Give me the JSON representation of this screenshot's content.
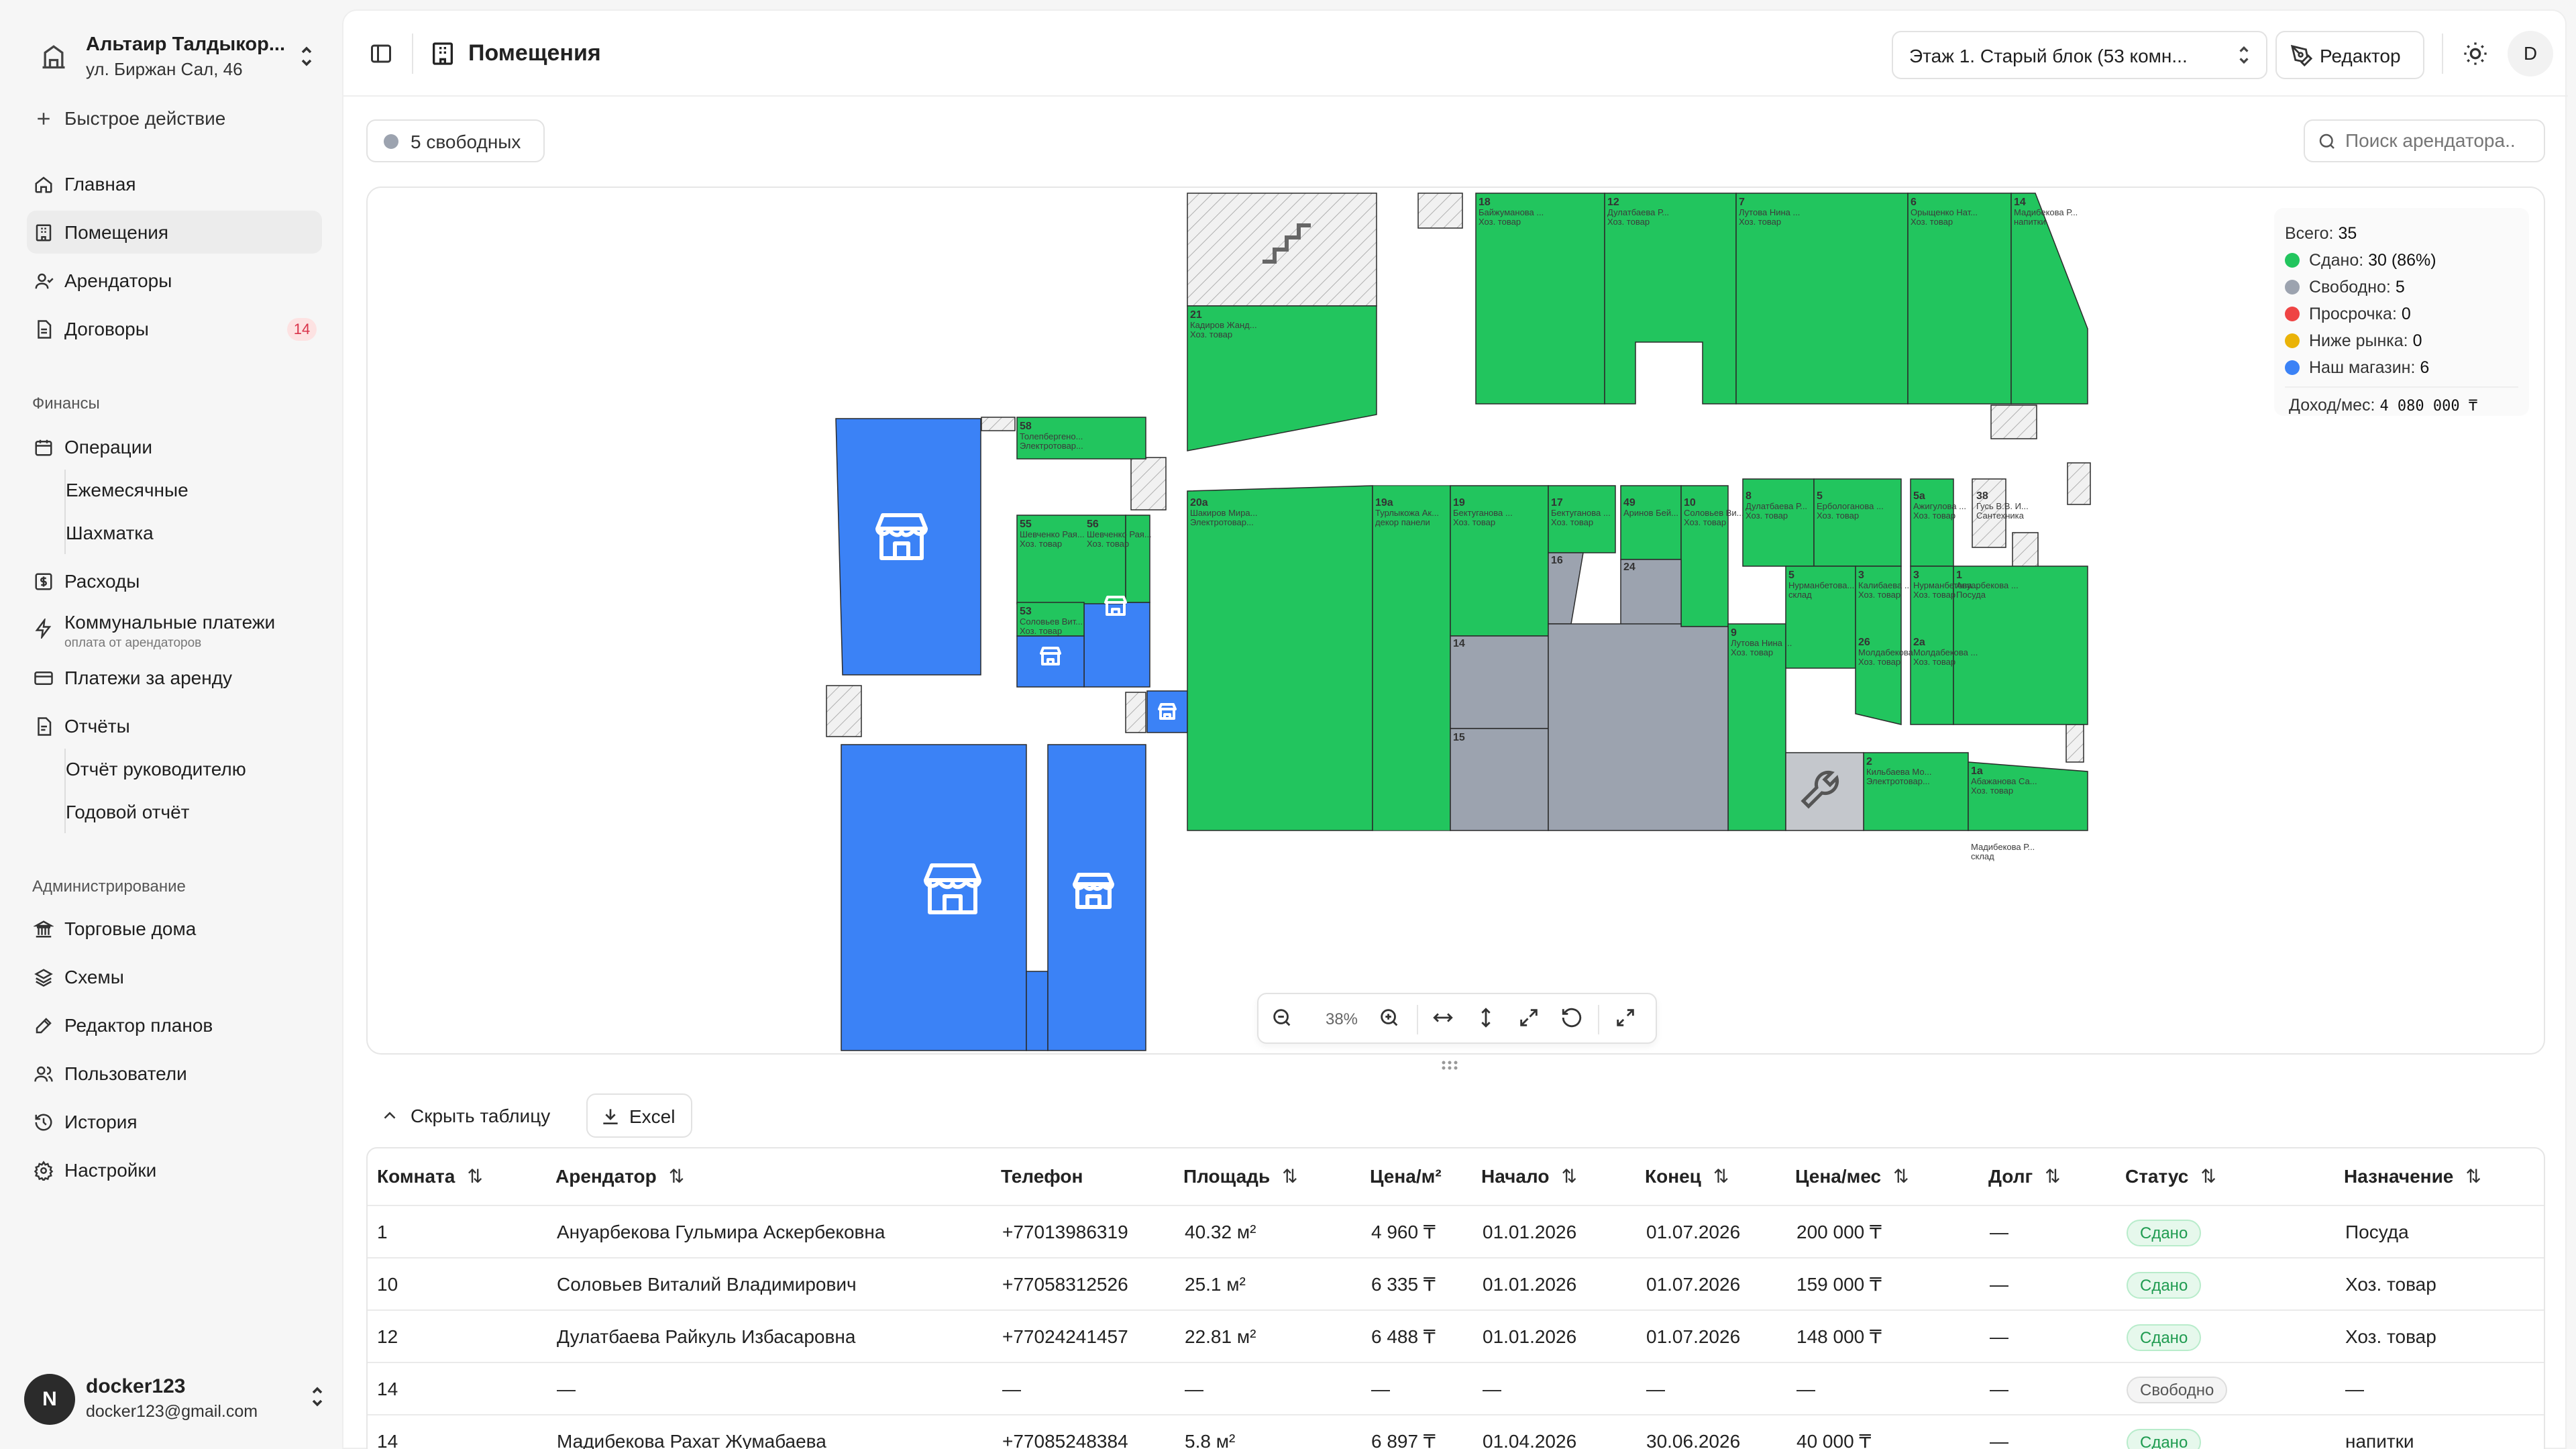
{
  "org": {
    "name": "Альтаир Талдыкор...",
    "address": "ул. Биржан Сал, 46"
  },
  "quick_action": "Быстрое действие",
  "nav": {
    "home": "Главная",
    "rooms": "Помещения",
    "tenants": "Арендаторы",
    "contracts": "Договоры",
    "contracts_badge": "14"
  },
  "finance": {
    "title": "Финансы",
    "operations": "Операции",
    "monthly": "Ежемесячные",
    "chess": "Шахматка",
    "expenses": "Расходы",
    "utilities": "Коммунальные платежи",
    "utilities_sub": "оплата от арендаторов",
    "rent": "Платежи за аренду",
    "reports": "Отчёты",
    "report_manager": "Отчёт руководителю",
    "report_year": "Годовой отчёт"
  },
  "admin": {
    "title": "Администрирование",
    "malls": "Торговые дома",
    "schemes": "Схемы",
    "plan_editor": "Редактор планов",
    "users": "Пользователи",
    "history": "История",
    "settings": "Настройки"
  },
  "user": {
    "initial": "N",
    "name": "docker123",
    "email": "docker123@gmail.com"
  },
  "header": {
    "title": "Помещения",
    "floor_select": "Этаж 1. Старый блок (53 комн...",
    "editor": "Редактор",
    "user_initial": "D"
  },
  "filter": {
    "free_label": "5 свободных",
    "search_placeholder": "Поиск арендатора.."
  },
  "legend": {
    "total_label": "Всего:",
    "total": "35",
    "rented_label": "Сдано:",
    "rented": "30 (86%)",
    "free_label": "Свободно:",
    "free": "5",
    "overdue_label": "Просрочка:",
    "overdue": "0",
    "below_label": "Ниже рынка:",
    "below": "0",
    "own_label": "Наш магазин:",
    "own": "6",
    "income_label": "Доход/мес:",
    "income": "4 080 000 ₸"
  },
  "zoom": {
    "level": "38%"
  },
  "table_controls": {
    "hide": "Скрыть таблицу",
    "excel": "Excel"
  },
  "table": {
    "columns": [
      "Комната",
      "Арендатор",
      "Телефон",
      "Площадь",
      "Цена/м²",
      "Начало",
      "Конец",
      "Цена/мес",
      "Долг",
      "Статус",
      "Назначение"
    ],
    "rows": [
      {
        "room": "1",
        "tenant": "Ануарбекова Гульмира Аскербековна",
        "phone": "+77013986319",
        "area": "40.32 м²",
        "price_m2": "4 960 ₸",
        "start": "01.01.2026",
        "end": "01.07.2026",
        "price_month": "200 000 ₸",
        "debt": "—",
        "status": "Сдано",
        "purpose": "Посуда"
      },
      {
        "room": "10",
        "tenant": "Соловьев Виталий Владимирович",
        "phone": "+77058312526",
        "area": "25.1 м²",
        "price_m2": "6 335 ₸",
        "start": "01.01.2026",
        "end": "01.07.2026",
        "price_month": "159 000 ₸",
        "debt": "—",
        "status": "Сдано",
        "purpose": "Хоз. товар"
      },
      {
        "room": "12",
        "tenant": "Дулатбаева Райкуль Избасаровна",
        "phone": "+77024241457",
        "area": "22.81 м²",
        "price_m2": "6 488 ₸",
        "start": "01.01.2026",
        "end": "01.07.2026",
        "price_month": "148 000 ₸",
        "debt": "—",
        "status": "Сдано",
        "purpose": "Хоз. товар"
      },
      {
        "room": "14",
        "tenant": "—",
        "phone": "—",
        "area": "—",
        "price_m2": "—",
        "start": "—",
        "end": "—",
        "price_month": "—",
        "debt": "—",
        "status": "Свободно",
        "purpose": "—"
      },
      {
        "room": "14",
        "tenant": "Мадибекова Рахат Жумабаева",
        "phone": "+77085248384",
        "area": "5.8 м²",
        "price_m2": "6 897 ₸",
        "start": "01.04.2026",
        "end": "30.06.2026",
        "price_month": "40 000 ₸",
        "debt": "—",
        "status": "Сдано",
        "purpose": "напитки"
      }
    ]
  },
  "colors": {
    "rented": "#22c55e",
    "free": "#9ca3af",
    "overdue": "#ef4444",
    "below": "#eab308",
    "own": "#3b82f6"
  },
  "map_rooms": [
    {
      "no": "18",
      "name": "Байжуманова ...",
      "kind": "Хоз. товар"
    },
    {
      "no": "12",
      "name": "Дулатбаева Р...",
      "kind": "Хоз. товар"
    },
    {
      "no": "7",
      "name": "Лутова Нина ...",
      "kind": "Хоз. товар"
    },
    {
      "no": "6",
      "name": "Орыщенко Нат...",
      "kind": "Хоз. товар"
    },
    {
      "no": "14",
      "name": "Мадибекова Р...",
      "kind": "напитки"
    },
    {
      "no": "21",
      "name": "Кадиров Жанд...",
      "kind": "Хоз. товар"
    },
    {
      "no": "58",
      "name": "Толепбергено...",
      "kind": "Электротовар..."
    },
    {
      "no": "20a",
      "name": "Шакиров Мира...",
      "kind": "Электротовар..."
    },
    {
      "no": "19a",
      "name": "Турлыкожа Ак...",
      "kind": "декор панели"
    },
    {
      "no": "19",
      "name": "Бектуганова ...",
      "kind": "Хоз. товар"
    },
    {
      "no": "17",
      "name": "Бектуганова ...",
      "kind": "Хоз. товар"
    },
    {
      "no": "49",
      "name": "Аринов Бей...",
      "kind": ""
    },
    {
      "no": "10",
      "name": "Соловьев Ви...",
      "kind": "Хоз. товар"
    },
    {
      "no": "8",
      "name": "Дулатбаева Р...",
      "kind": "Хоз. товар"
    },
    {
      "no": "5",
      "name": "Ербологанова ...",
      "kind": "Хоз. товар"
    },
    {
      "no": "5a",
      "name": "Ажигулова ...",
      "kind": "Хоз. товар"
    },
    {
      "no": "38",
      "name": "Гусь В.В. И...",
      "kind": "Сантехника"
    },
    {
      "no": "55",
      "name": "Шевченко Рая...",
      "kind": "Хоз. товар"
    },
    {
      "no": "56",
      "name": "Шевченко Рая...",
      "kind": "Хоз. товар"
    },
    {
      "no": "53",
      "name": "Соловьев Вит...",
      "kind": "Хоз. товар"
    },
    {
      "no": "16",
      "name": "",
      "kind": ""
    },
    {
      "no": "24",
      "name": "",
      "kind": ""
    },
    {
      "no": "14",
      "name": "",
      "kind": ""
    },
    {
      "no": "15",
      "name": "",
      "kind": ""
    },
    {
      "no": "9",
      "name": "Лутова Нина ...",
      "kind": "Хоз. товар"
    },
    {
      "no": "5",
      "name": "Нурманбетова...",
      "kind": "склад"
    },
    {
      "no": "3",
      "name": "Калибаева ...",
      "kind": "Хоз. товар"
    },
    {
      "no": "3",
      "name": "Нурманбетова...",
      "kind": "Хоз. товар"
    },
    {
      "no": "1",
      "name": "Ануарбекова ...",
      "kind": "Посуда"
    },
    {
      "no": "26",
      "name": "Молдабекова ...",
      "kind": "Хоз. товар"
    },
    {
      "no": "2a",
      "name": "Молдабекова ...",
      "kind": "Хоз. товар"
    },
    {
      "no": "2",
      "name": "Кильбаева Мо...",
      "kind": "Электротовар..."
    },
    {
      "no": "1a",
      "name": "Абажанова Са...",
      "kind": "Хоз. товар"
    },
    {
      "no": "",
      "name": "Мадибекова Р...",
      "kind": "склад"
    }
  ]
}
